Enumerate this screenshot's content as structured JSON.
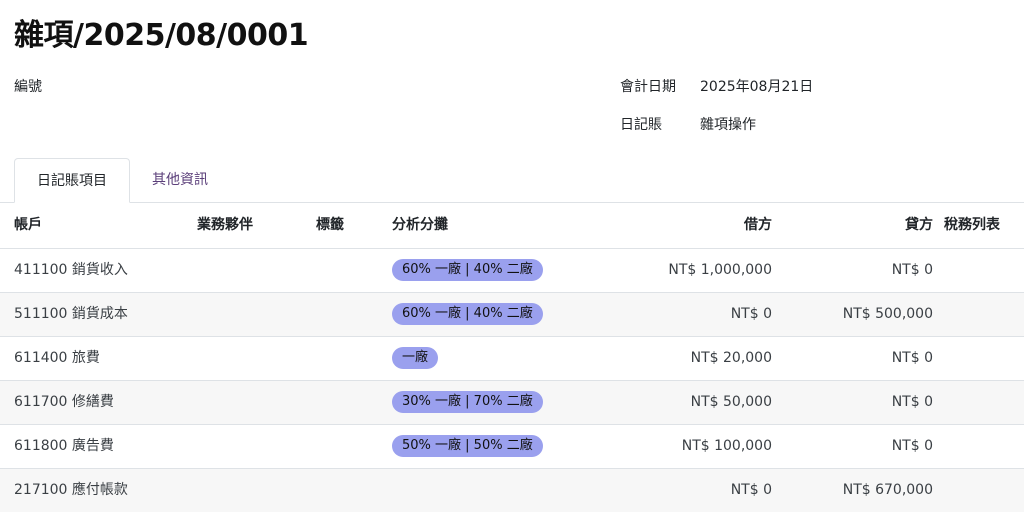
{
  "record": {
    "title": "雜項/2025/08/0001",
    "ref_label": "編號",
    "date_label": "會計日期",
    "date_value": "2025年08月21日",
    "journal_label": "日記賬",
    "journal_value": "雜項操作"
  },
  "tabs": [
    {
      "label": "日記賬項目",
      "active": true
    },
    {
      "label": "其他資訊",
      "active": false
    }
  ],
  "table": {
    "headers": {
      "account": "帳戶",
      "partner": "業務夥伴",
      "labels": "標籤",
      "analytic": "分析分攤",
      "debit": "借方",
      "credit": "貸方",
      "tax_grid": "稅務列表"
    },
    "rows": [
      {
        "account": "411100 銷貨收入",
        "analytic": "60% 一廠 | 40% 二廠",
        "debit": "NT$ 1,000,000",
        "credit": "NT$ 0"
      },
      {
        "account": "511100 銷貨成本",
        "analytic": "60% 一廠 | 40% 二廠",
        "debit": "NT$ 0",
        "credit": "NT$ 500,000"
      },
      {
        "account": "611400 旅費",
        "analytic": "一廠",
        "debit": "NT$ 20,000",
        "credit": "NT$ 0"
      },
      {
        "account": "611700 修繕費",
        "analytic": "30% 一廠 | 70% 二廠",
        "debit": "NT$ 50,000",
        "credit": "NT$ 0"
      },
      {
        "account": "611800 廣告費",
        "analytic": "50% 一廠 | 50% 二廠",
        "debit": "NT$ 100,000",
        "credit": "NT$ 0"
      },
      {
        "account": "217100 應付帳款",
        "analytic": "",
        "debit": "NT$ 0",
        "credit": "NT$ 670,000"
      }
    ]
  },
  "colors": {
    "analytic_tag_bg": "#9aa0ee",
    "tab_inactive_text": "#5b3f7a",
    "row_alt_bg": "#f7f7f7"
  }
}
